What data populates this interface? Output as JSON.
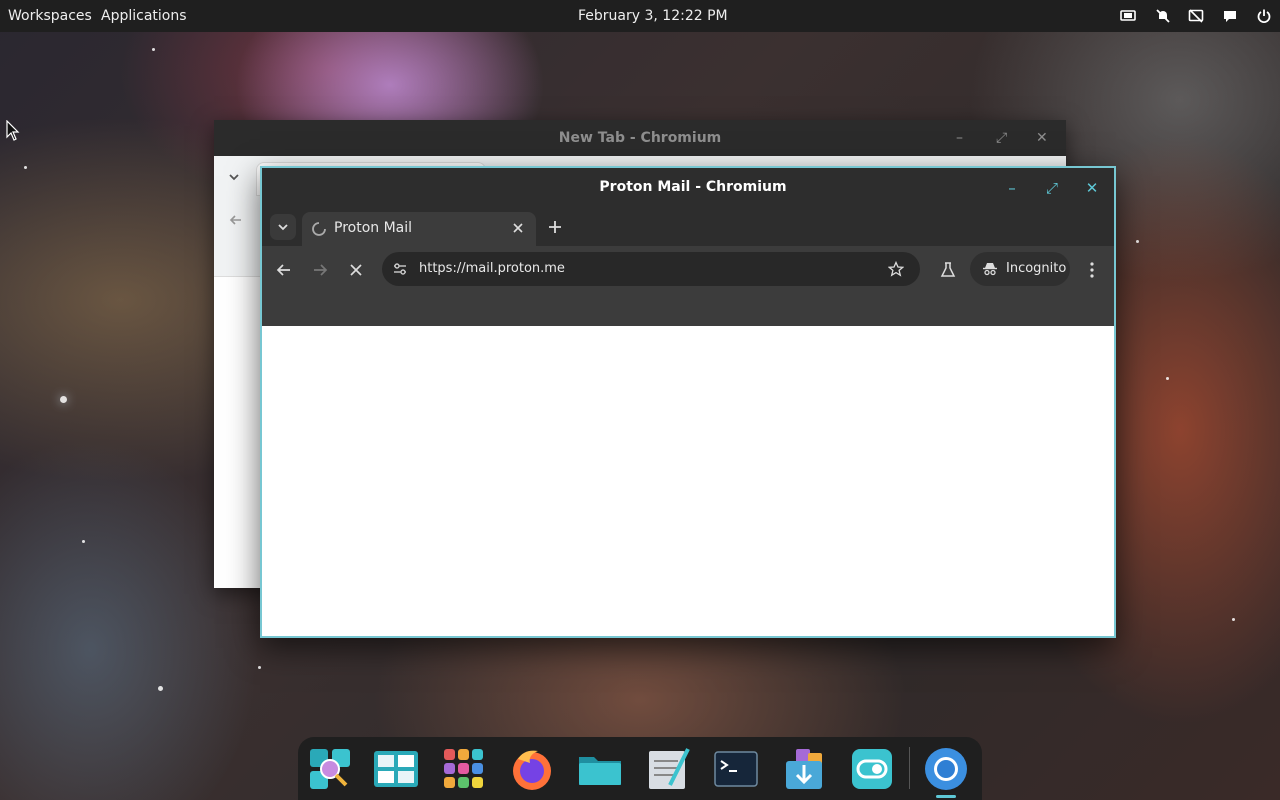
{
  "topbar": {
    "workspaces": "Workspaces",
    "applications": "Applications",
    "datetime": "February 3, 12:22 PM",
    "tray_icons": [
      "display-icon",
      "notifications-muted-icon",
      "screen-share-off-icon",
      "chat-icon",
      "power-icon"
    ]
  },
  "back_window": {
    "title": "New Tab - Chromium",
    "controls": [
      "minimize",
      "maximize",
      "close"
    ]
  },
  "front_window": {
    "title": "Proton Mail - Chromium",
    "tab_title": "Proton Mail",
    "url": "https://mail.proton.me",
    "incognito_label": "Incognito",
    "accent_color": "#5ec8d6"
  },
  "dock": {
    "apps": [
      "search-app",
      "workspace-app",
      "app-grid",
      "firefox",
      "files",
      "text-editor",
      "terminal",
      "software-store",
      "toggle-app",
      "chromium"
    ]
  }
}
